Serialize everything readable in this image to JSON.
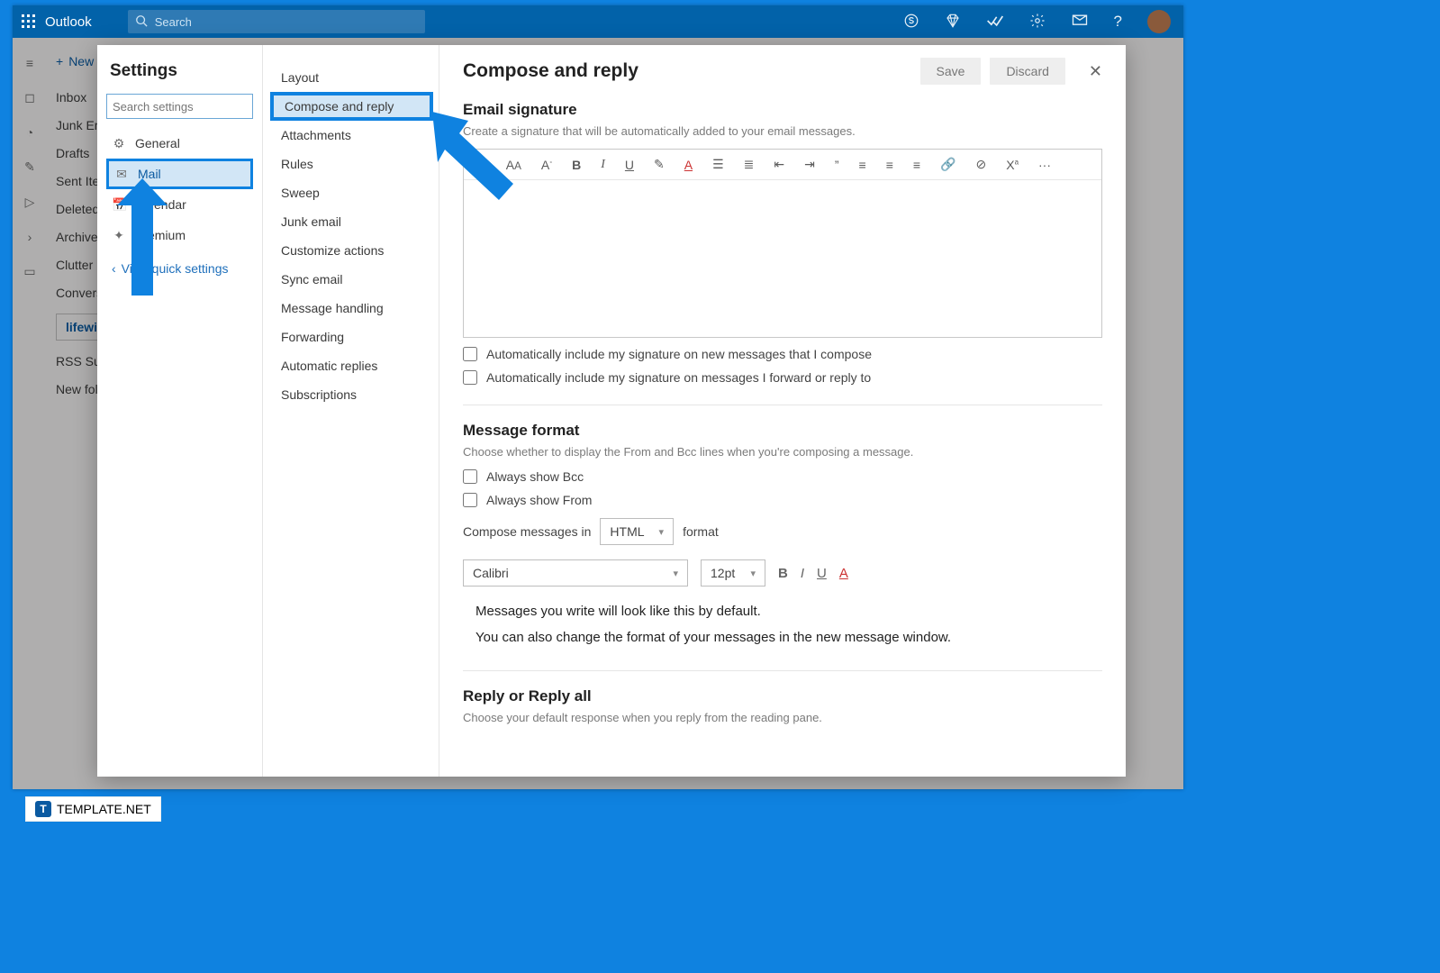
{
  "topbar": {
    "brand": "Outlook",
    "search_placeholder": "Search"
  },
  "bg": {
    "new_label": "New",
    "folders": [
      "Inbox",
      "Junk Em",
      "Drafts",
      "Sent Ite",
      "Deleted",
      "Archive",
      "Clutter",
      "Convers",
      "lifewire",
      "RSS Sub",
      "New fol"
    ],
    "selected_index": 8
  },
  "settings": {
    "title": "Settings",
    "search_placeholder": "Search settings",
    "items": [
      {
        "icon": "⚙",
        "label": "General"
      },
      {
        "icon": "✉",
        "label": "Mail"
      },
      {
        "icon": "📅",
        "label": "Calendar"
      },
      {
        "icon": "✦",
        "label": "Premium"
      }
    ],
    "active_index": 1,
    "quick_link": "View quick settings"
  },
  "subnav": {
    "items": [
      "Layout",
      "Compose and reply",
      "Attachments",
      "Rules",
      "Sweep",
      "Junk email",
      "Customize actions",
      "Sync email",
      "Message handling",
      "Forwarding",
      "Automatic replies",
      "Subscriptions"
    ],
    "active_index": 1
  },
  "content": {
    "title": "Compose and reply",
    "save": "Save",
    "discard": "Discard",
    "sig": {
      "heading": "Email signature",
      "desc": "Create a signature that will be automatically added to your email messages.",
      "chk1": "Automatically include my signature on new messages that I compose",
      "chk2": "Automatically include my signature on messages I forward or reply to",
      "tools": {
        "b": "B",
        "i": "I",
        "u": "U",
        "more": "···"
      }
    },
    "fmt": {
      "heading": "Message format",
      "desc": "Choose whether to display the From and Bcc lines when you're composing a message.",
      "bcc": "Always show Bcc",
      "from": "Always show From",
      "compose_in_pre": "Compose messages in",
      "compose_in_value": "HTML",
      "compose_in_post": "format",
      "font": "Calibri",
      "size": "12pt",
      "preview1": "Messages you write will look like this by default.",
      "preview2": "You can also change the format of your messages in the new message window."
    },
    "reply": {
      "heading": "Reply or Reply all",
      "desc": "Choose your default response when you reply from the reading pane."
    }
  },
  "watermark": "TEMPLATE.NET"
}
